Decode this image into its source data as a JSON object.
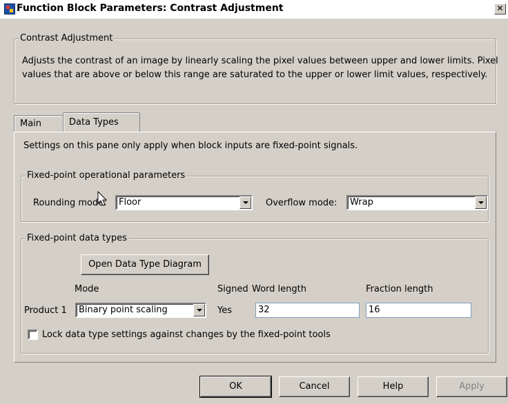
{
  "window": {
    "title": "Function Block Parameters: Contrast Adjustment",
    "close_glyph": "✕"
  },
  "block": {
    "group_title": "Contrast Adjustment",
    "description": "Adjusts the contrast of an image by linearly scaling the pixel values between upper and lower limits. Pixel values that are above or below this range are saturated to the upper or lower limit values, respectively."
  },
  "tabs": [
    {
      "label": "Main",
      "active": false
    },
    {
      "label": "Data Types",
      "active": true
    }
  ],
  "pane": {
    "info": "Settings on this pane only apply when block inputs are fixed-point signals.",
    "operational": {
      "title": "Fixed-point operational parameters",
      "rounding_label": "Rounding mode:",
      "rounding_value": "Floor",
      "overflow_label": "Overflow mode:",
      "overflow_value": "Wrap"
    },
    "data_types": {
      "title": "Fixed-point data types",
      "diagram_button": "Open Data Type Diagram",
      "columns": {
        "mode": "Mode",
        "signed": "Signed",
        "word": "Word length",
        "fraction": "Fraction length"
      },
      "rows": [
        {
          "name": "Product 1",
          "mode": "Binary point scaling",
          "signed": "Yes",
          "word_length": "32",
          "fraction_length": "16"
        }
      ],
      "lock_label": "Lock data type settings against changes by the fixed-point tools",
      "lock_checked": false
    }
  },
  "footer": {
    "ok": "OK",
    "cancel": "Cancel",
    "help": "Help",
    "apply": "Apply"
  },
  "icons": {
    "window": "simulink-block-icon",
    "close": "close-icon",
    "dropdown": "chevron-down-icon",
    "pointer": "mouse-pointer-icon"
  }
}
